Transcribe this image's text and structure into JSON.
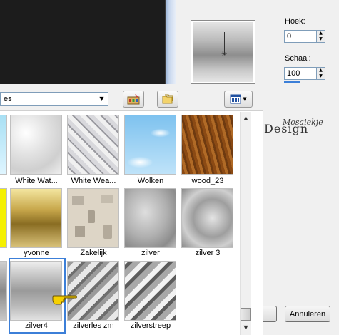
{
  "dialog": {
    "angle_label": "Hoek:",
    "angle_value": "0",
    "scale_label": "Schaal:",
    "scale_value": "100",
    "cancel_label": "Annuleren",
    "logo_text": "Design",
    "logo_script": "Mosaiekje"
  },
  "picker": {
    "category_value": "es",
    "tiles": [
      {
        "label": "White Wat..."
      },
      {
        "label": "White Wea..."
      },
      {
        "label": "Wolken"
      },
      {
        "label": "wood_23"
      },
      {
        "label": "yvonne"
      },
      {
        "label": "Zakelijk"
      },
      {
        "label": "zilver"
      },
      {
        "label": "zilver 3"
      },
      {
        "label": "zilver4"
      },
      {
        "label": "zilverles zm"
      },
      {
        "label": "zilverstreep"
      }
    ]
  }
}
